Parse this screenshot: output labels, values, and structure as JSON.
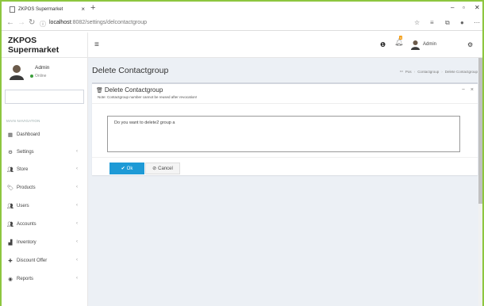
{
  "browser": {
    "tab_title": "ZKPOS Supermarket",
    "tab_close": "×",
    "new_tab": "+",
    "url_host": "localhost",
    "url_path": ":8082/settings/delcontactgroup",
    "win_minimize": "–",
    "win_maximize": "▫",
    "win_close": "✕"
  },
  "header": {
    "brand": "ZKPOS Supermarket",
    "user_label": "Admin",
    "notification_count": "4"
  },
  "sidebar": {
    "user_name": "Admin",
    "status": "Online",
    "section_label": "MAIN NAVIGATION",
    "items": [
      {
        "label": "Dashboard",
        "icon": "dashboard-icon",
        "has_children": false
      },
      {
        "label": "Settings",
        "icon": "gear-icon",
        "has_children": true
      },
      {
        "label": "Store",
        "icon": "users-icon",
        "has_children": true
      },
      {
        "label": "Products",
        "icon": "tags-icon",
        "has_children": true
      },
      {
        "label": "Users",
        "icon": "users-icon",
        "has_children": true
      },
      {
        "label": "Accounts",
        "icon": "users-icon",
        "has_children": true
      },
      {
        "label": "Inventory",
        "icon": "bar-chart-icon",
        "has_children": true
      },
      {
        "label": "Discount Offer",
        "icon": "plus-icon",
        "has_children": true
      },
      {
        "label": "Reports",
        "icon": "eye-icon",
        "has_children": true
      }
    ],
    "chevron": "‹"
  },
  "content": {
    "page_title": "Delete Contactgroup",
    "breadcrumb": [
      "Pos",
      "Contactgroup",
      "Delete Contactgroup"
    ],
    "box_title": "Delete Contactgroup",
    "box_note": "Note: Contactgroup number cannot be reused after revocation!",
    "confirm_text": "Do you want to delete2 group a",
    "ok_label": "Ok",
    "cancel_label": "Cancel",
    "collapse": "−",
    "remove": "×"
  },
  "colors": {
    "accent_green": "#8dc63f",
    "primary_button": "#1e9ad6",
    "badge": "#f39c12",
    "content_bg": "#ecf0f5"
  }
}
